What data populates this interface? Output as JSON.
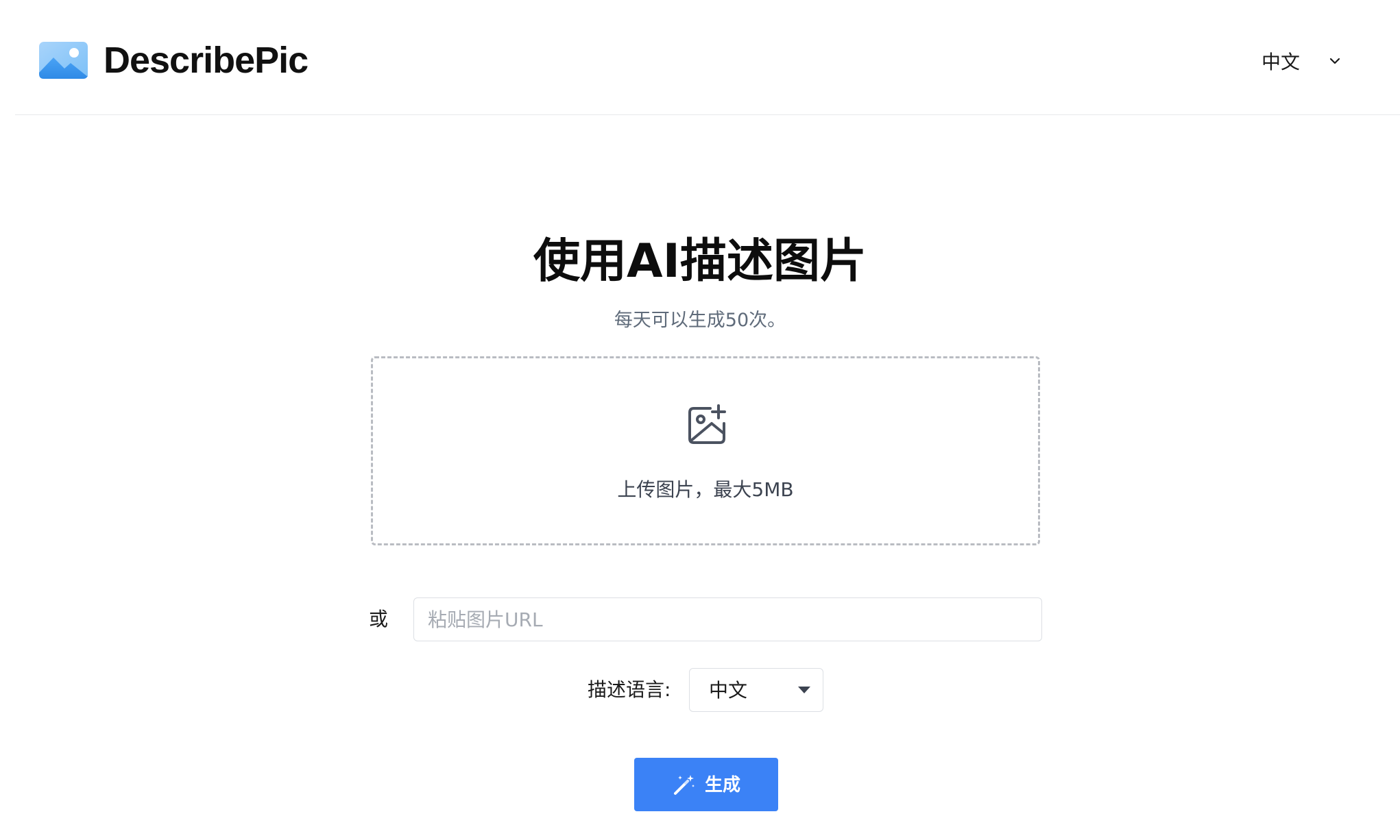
{
  "header": {
    "brand_name": "DescribePic",
    "logo_icon": "mountain-landscape-image-icon",
    "language_switch": {
      "label": "中文",
      "icon": "chevron-down-icon"
    }
  },
  "main": {
    "title": "使用AI描述图片",
    "subtitle": "每天可以生成50次。",
    "upload": {
      "icon": "image-plus-icon",
      "text": "上传图片，最大5MB"
    },
    "or_label": "或",
    "url_input": {
      "value": "",
      "placeholder": "粘贴图片URL"
    },
    "description_language": {
      "label": "描述语言:",
      "selected": "中文"
    },
    "generate_button": {
      "label": "生成",
      "icon": "magic-wand-icon"
    }
  },
  "colors": {
    "accent": "#3b82f6",
    "subtitle_text": "#5f6b7a",
    "border": "#dcdfe4",
    "dashed_border": "#b9bcc2"
  }
}
